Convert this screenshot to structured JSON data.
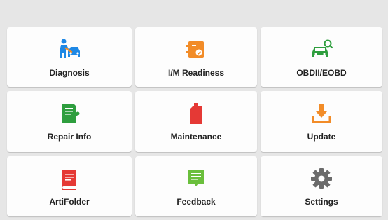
{
  "tiles": [
    {
      "label": "Diagnosis",
      "icon": "diagnosis-icon",
      "color": "#1e88e5"
    },
    {
      "label": "I/M Readiness",
      "icon": "im-readiness-icon",
      "color": "#f28c28"
    },
    {
      "label": "OBDII/EOBD",
      "icon": "obd-car-icon",
      "color": "#2e9e3e"
    },
    {
      "label": "Repair Info",
      "icon": "repair-info-icon",
      "color": "#2e9e3e"
    },
    {
      "label": "Maintenance",
      "icon": "oil-can-icon",
      "color": "#e53935"
    },
    {
      "label": "Update",
      "icon": "download-icon",
      "color": "#f28c28"
    },
    {
      "label": "ArtiFolder",
      "icon": "folder-book-icon",
      "color": "#e53935"
    },
    {
      "label": "Feedback",
      "icon": "feedback-icon",
      "color": "#6abf3c"
    },
    {
      "label": "Settings",
      "icon": "gear-icon",
      "color": "#6b6b6b"
    }
  ]
}
